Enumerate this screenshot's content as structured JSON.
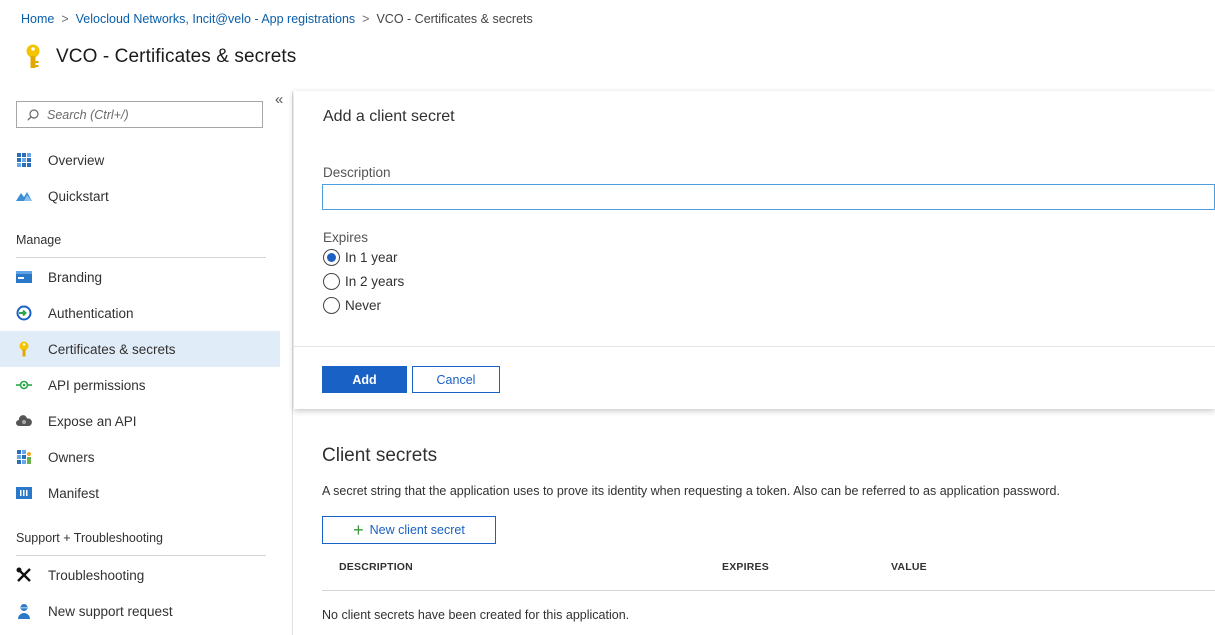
{
  "breadcrumb": {
    "items": [
      "Home",
      "Velocloud Networks, Incit@velo - App registrations",
      "VCO - Certificates & secrets"
    ],
    "separator": ">"
  },
  "page": {
    "title": "VCO - Certificates & secrets",
    "icon": "key-icon"
  },
  "sidebar": {
    "search_placeholder": "Search (Ctrl+/)",
    "collapse_label": "«",
    "items_top": [
      {
        "label": "Overview",
        "icon": "overview-icon"
      },
      {
        "label": "Quickstart",
        "icon": "quickstart-icon"
      }
    ],
    "manage_header": "Manage",
    "manage_items": [
      {
        "label": "Branding",
        "icon": "branding-icon"
      },
      {
        "label": "Authentication",
        "icon": "authentication-icon"
      },
      {
        "label": "Certificates & secrets",
        "icon": "key-icon",
        "selected": true
      },
      {
        "label": "API permissions",
        "icon": "api-permissions-icon"
      },
      {
        "label": "Expose an API",
        "icon": "cloud-icon"
      },
      {
        "label": "Owners",
        "icon": "owners-icon"
      },
      {
        "label": "Manifest",
        "icon": "manifest-icon"
      }
    ],
    "support_header": "Support + Troubleshooting",
    "support_items": [
      {
        "label": "Troubleshooting",
        "icon": "wrench-icon"
      },
      {
        "label": "New support request",
        "icon": "support-person-icon"
      }
    ]
  },
  "add_secret": {
    "heading": "Add a client secret",
    "description_label": "Description",
    "description_value": "",
    "expires_label": "Expires",
    "options": [
      {
        "label": "In 1 year",
        "checked": true
      },
      {
        "label": "In 2 years",
        "checked": false
      },
      {
        "label": "Never",
        "checked": false
      }
    ],
    "add_label": "Add",
    "cancel_label": "Cancel"
  },
  "client_secrets": {
    "heading": "Client secrets",
    "description": "A secret string that the application uses to prove its identity when requesting a token. Also can be referred to as application password.",
    "new_button_label": "New client secret",
    "columns": [
      "DESCRIPTION",
      "EXPIRES",
      "VALUE"
    ],
    "empty_message": "No client secrets have been created for this application."
  },
  "colors": {
    "accent": "#1961c5",
    "link": "#0a5ea8",
    "selected_bg": "#e1ecf9",
    "key": "#f5c400"
  }
}
